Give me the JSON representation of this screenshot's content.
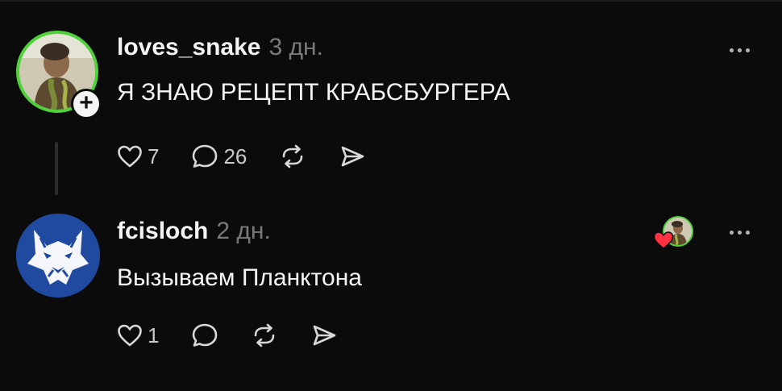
{
  "posts": [
    {
      "username": "loves_snake",
      "time": "3 дн.",
      "text": "Я ЗНАЮ РЕЦЕПТ КРАБСБУРГЕРА",
      "likes": "7",
      "comments": "26",
      "avatar_icon": "person-photo-avatar",
      "avatar_ring_color": "#4fd13a",
      "has_follow_badge": true
    },
    {
      "username": "fcisloch",
      "time": "2 дн.",
      "text": "Вызываем Планктона",
      "likes": "1",
      "comments": "",
      "avatar_icon": "wolf-logo-avatar",
      "avatar_color": "#1f4aa0",
      "liked_by_author": true
    }
  ],
  "icons": {
    "like": "heart-outline-icon",
    "comment": "speech-bubble-icon",
    "repost": "repost-arrows-icon",
    "share": "send-paper-plane-icon",
    "more": "ellipsis-icon",
    "liked_heart": "heart-filled-icon"
  },
  "colors": {
    "background": "#0b0b0b",
    "text": "#f4f4f4",
    "muted": "#7a7a7a",
    "ring": "#4fd13a",
    "heart": "#ff3040"
  }
}
